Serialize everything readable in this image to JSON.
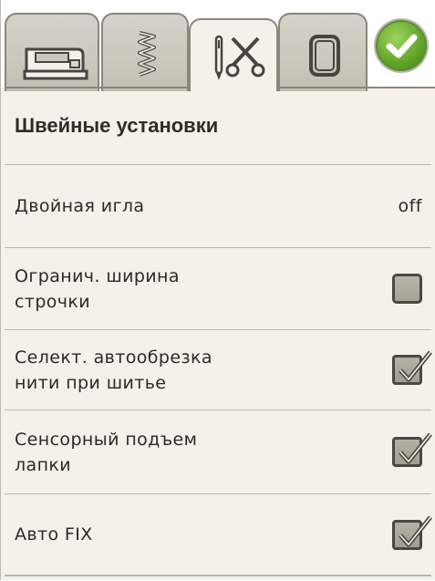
{
  "tabs": [
    {
      "icon": "sewing-machine-icon"
    },
    {
      "icon": "zigzag-stitch-icon"
    },
    {
      "icon": "needle-scissors-icon",
      "active": true
    },
    {
      "icon": "embroidery-hoop-icon"
    }
  ],
  "ok_button": {
    "icon": "checkmark-icon",
    "color": "#63a62a"
  },
  "panel": {
    "title": "Швейные установки",
    "rows": [
      {
        "label": "Двойная игла",
        "value": "off"
      },
      {
        "label": "Огранич. ширина\nстрочки",
        "checked": false
      },
      {
        "label": "Селект. автообрезка\nнити при шитье",
        "checked": true
      },
      {
        "label": "Сенсорный подъем\nлапки",
        "checked": true
      },
      {
        "label": "Авто FIX",
        "checked": true
      }
    ]
  }
}
